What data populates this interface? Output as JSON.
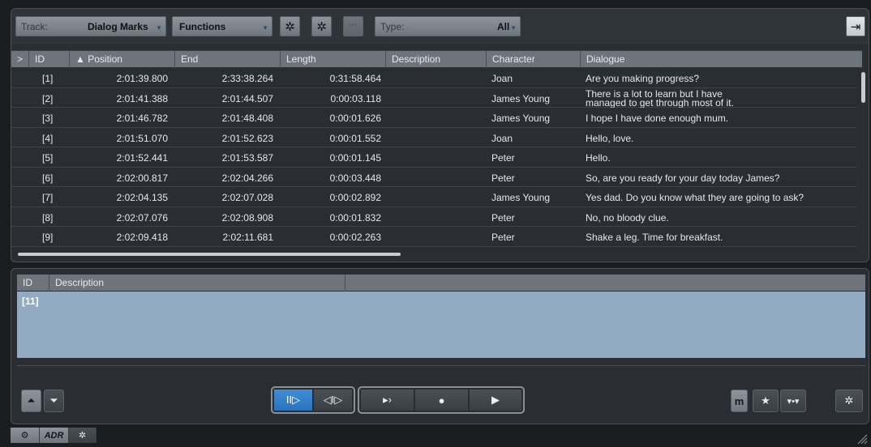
{
  "toolbar": {
    "track_label": "Track:",
    "track_value": "Dialog Marks",
    "functions_label": "Functions",
    "type_label": "Type:",
    "type_value": "All",
    "gear_glyph": "✲",
    "goto_start_glyph": "⏮",
    "dock_glyph": "⇥"
  },
  "columns": [
    "ID",
    "Position",
    "End",
    "Length",
    "Description",
    "Character",
    "Dialogue"
  ],
  "expand_glyph": ">",
  "sort_glyph": "▲",
  "rows": [
    {
      "id": "[1]",
      "position": "2:01:39.800",
      "end": "2:33:38.264",
      "length": "0:31:58.464",
      "character": "Joan",
      "dialogue": "Are you making progress?"
    },
    {
      "id": "[2]",
      "position": "2:01:41.388",
      "end": "2:01:44.507",
      "length": "0:00:03.118",
      "character": "James Young",
      "dialogue": "There is a lot to learn but I have managed to get through most of it."
    },
    {
      "id": "[3]",
      "position": "2:01:46.782",
      "end": "2:01:48.408",
      "length": "0:00:01.626",
      "character": "James Young",
      "dialogue": "I hope I have done enough mum."
    },
    {
      "id": "[4]",
      "position": "2:01:51.070",
      "end": "2:01:52.623",
      "length": "0:00:01.552",
      "character": "Joan",
      "dialogue": "Hello, love."
    },
    {
      "id": "[5]",
      "position": "2:01:52.441",
      "end": "2:01:53.587",
      "length": "0:00:01.145",
      "character": "Peter",
      "dialogue": "Hello."
    },
    {
      "id": "[6]",
      "position": "2:02:00.817",
      "end": "2:02:04.266",
      "length": "0:00:03.448",
      "character": "Peter",
      "dialogue": "So, are you ready for your day today James?"
    },
    {
      "id": "[7]",
      "position": "2:02:04.135",
      "end": "2:02:07.028",
      "length": "0:00:02.892",
      "character": "James Young",
      "dialogue": "Yes dad. Do you know what they are going to ask?"
    },
    {
      "id": "[8]",
      "position": "2:02:07.076",
      "end": "2:02:08.908",
      "length": "0:00:01.832",
      "character": "Peter",
      "dialogue": "No, no bloody clue."
    },
    {
      "id": "[9]",
      "position": "2:02:09.418",
      "end": "2:02:11.681",
      "length": "0:00:02.263",
      "character": "Peter",
      "dialogue": "Shake a leg. Time for breakfast."
    }
  ],
  "description_panel": {
    "col_id": "ID",
    "col_description": "Description",
    "selected_id": "[11]",
    "selection_color": "#93aac3"
  },
  "transport": {
    "move_up_glyph": "⏶",
    "move_down_glyph": "⏷",
    "mode_a_glyph": "II▷",
    "mode_b_glyph": "◁I▷",
    "cue_glyph": "▸›",
    "record_glyph": "●",
    "play_glyph": "▶",
    "m_label": "m",
    "star_glyph": "★",
    "markers_glyph": "▾•▾",
    "settings_glyph": "✲"
  },
  "footer": {
    "adr_label": "ADR",
    "setup_glyph": "⚙",
    "gear_glyph": "✲"
  },
  "accent_color": "#2a74bf"
}
